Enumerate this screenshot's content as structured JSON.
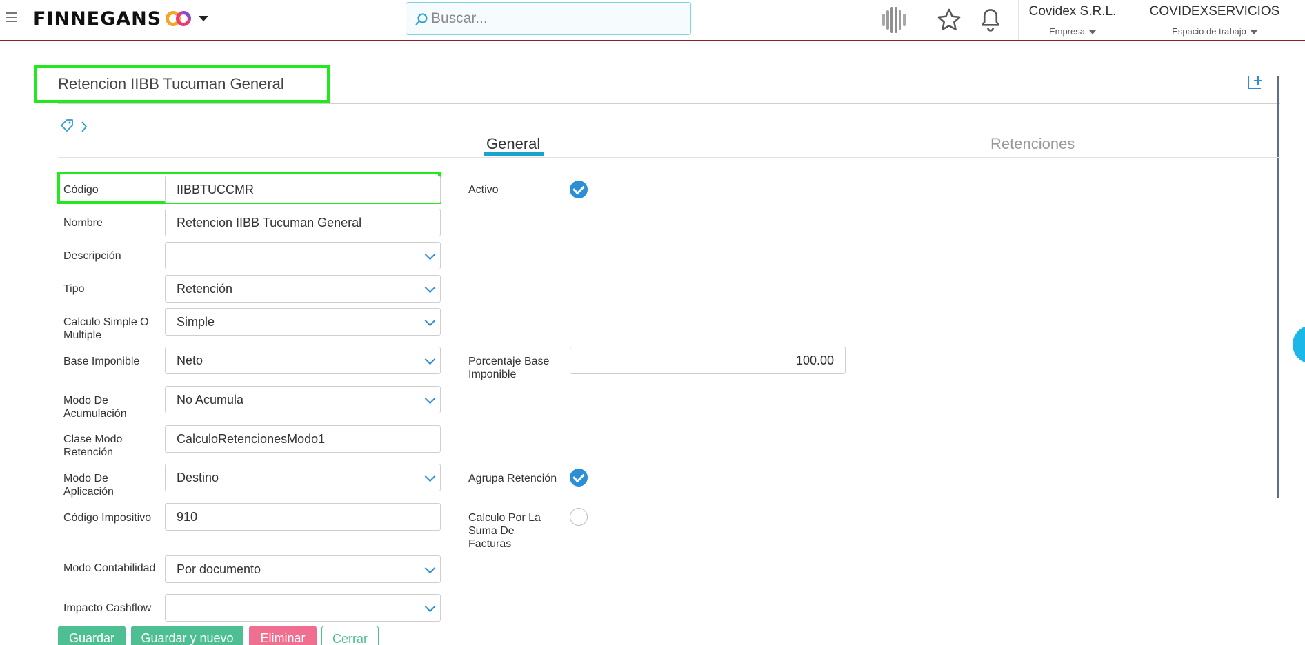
{
  "header": {
    "brand": "FINNEGANS",
    "search_placeholder": "Buscar...",
    "company_name": "Covidex S.R.L.",
    "company_label": "Empresa",
    "workspace_name": "COVIDEXSERVICIOS",
    "workspace_label": "Espacio de trabajo"
  },
  "page": {
    "title": "Retencion IIBB Tucuman General"
  },
  "tabs": [
    {
      "label": "General",
      "active": true
    },
    {
      "label": "Retenciones",
      "active": false
    }
  ],
  "form": {
    "codigo": {
      "label": "Código",
      "value": "IIBBTUCCMR"
    },
    "nombre": {
      "label": "Nombre",
      "value": "Retencion IIBB Tucuman General"
    },
    "descripcion": {
      "label": "Descripción",
      "value": ""
    },
    "tipo": {
      "label": "Tipo",
      "value": "Retención"
    },
    "calculo": {
      "label": "Calculo Simple O Multiple",
      "value": "Simple"
    },
    "base_imponible": {
      "label": "Base Imponible",
      "value": "Neto"
    },
    "modo_acumulacion": {
      "label": "Modo De Acumulación",
      "value": "No Acumula"
    },
    "clase_modo": {
      "label": "Clase Modo Retención",
      "value": "CalculoRetencionesModo1"
    },
    "modo_aplicacion": {
      "label": "Modo De Aplicación",
      "value": "Destino"
    },
    "codigo_impositivo": {
      "label": "Código Impositivo",
      "value": "910"
    },
    "modo_contabilidad": {
      "label": "Modo Contabilidad",
      "value": "Por documento"
    },
    "impacto_cashflow": {
      "label": "Impacto Cashflow",
      "value": ""
    },
    "activo": {
      "label": "Activo",
      "checked": true
    },
    "porcentaje_base": {
      "label": "Porcentaje Base Imponible",
      "value": "100.00"
    },
    "agrupa_retencion": {
      "label": "Agrupa Retención",
      "checked": true
    },
    "calculo_suma": {
      "label": "Calculo Por La Suma De Facturas",
      "checked": false
    }
  },
  "buttons": {
    "guardar": "Guardar",
    "guardar_nuevo": "Guardar y nuevo",
    "eliminar": "Eliminar",
    "cerrar": "Cerrar"
  },
  "colors": {
    "accent": "#1aa3d1",
    "success": "#4dbf93",
    "danger": "#f06e8f",
    "highlight": "#22e81e",
    "check": "#2a8fd6"
  }
}
